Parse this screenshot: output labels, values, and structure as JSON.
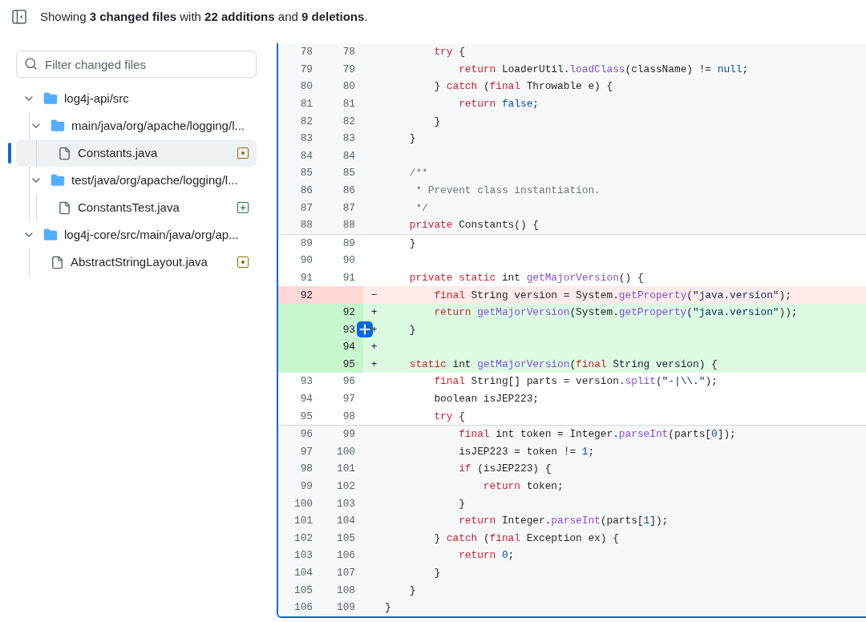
{
  "header": {
    "summary": "Showing **3 changed files** with **22 additions** and **9 deletions**."
  },
  "sidebar": {
    "search": {
      "placeholder": "Filter changed files"
    },
    "tree": [
      {
        "name": "log4j-api/src",
        "kind": "folder",
        "expanded": true,
        "selected": false,
        "children": [
          {
            "name": "main/java/org/apache/logging/l...",
            "kind": "folder",
            "expanded": true,
            "selected": false,
            "children": [
              {
                "name": "Constants.java",
                "kind": "modified_file",
                "selected": true
              }
            ]
          },
          {
            "name": "test/java/org/apache/logging/l...",
            "kind": "folder",
            "expanded": true,
            "selected": false,
            "children": [
              {
                "name": "ConstantsTest.java",
                "kind": "added_file",
                "selected": false
              }
            ]
          }
        ]
      },
      {
        "name": "log4j-core/src/main/java/org/ap...",
        "kind": "folder",
        "expanded": true,
        "selected": false,
        "children": [
          {
            "name": "AbstractStringLayout.java",
            "kind": "modified_file",
            "selected": false
          }
        ]
      }
    ]
  },
  "diff": {
    "rows": [
      {
        "kind": "expanded",
        "old": "78",
        "new": "78",
        "comment_button": false,
        "tokens": [
          {
            "kind": "keyword",
            "text": "        try"
          },
          {
            "kind": "plain",
            "text": " {"
          }
        ]
      },
      {
        "kind": "expanded",
        "old": "79",
        "new": "79",
        "comment_button": false,
        "tokens": [
          {
            "kind": "keyword",
            "text": "            return"
          },
          {
            "kind": "plain",
            "text": " LoaderUtil."
          },
          {
            "kind": "function",
            "text": "loadClass"
          },
          {
            "kind": "plain",
            "text": "(className) != "
          },
          {
            "kind": "constant",
            "text": "null"
          },
          {
            "kind": "plain",
            "text": ";"
          }
        ]
      },
      {
        "kind": "expanded",
        "old": "80",
        "new": "80",
        "comment_button": false,
        "tokens": [
          {
            "kind": "plain",
            "text": "        } "
          },
          {
            "kind": "keyword",
            "text": "catch"
          },
          {
            "kind": "plain",
            "text": " ("
          },
          {
            "kind": "keyword",
            "text": "final"
          },
          {
            "kind": "plain",
            "text": " Throwable e) {"
          }
        ]
      },
      {
        "kind": "expanded",
        "old": "81",
        "new": "81",
        "comment_button": false,
        "tokens": [
          {
            "kind": "keyword",
            "text": "            return"
          },
          {
            "kind": "constant",
            "text": " false"
          },
          {
            "kind": "plain",
            "text": ";"
          }
        ]
      },
      {
        "kind": "expanded",
        "old": "82",
        "new": "82",
        "comment_button": false,
        "tokens": [
          {
            "kind": "plain",
            "text": "        }"
          }
        ]
      },
      {
        "kind": "expanded",
        "old": "83",
        "new": "83",
        "comment_button": false,
        "tokens": [
          {
            "kind": "plain",
            "text": "    }"
          }
        ]
      },
      {
        "kind": "expanded",
        "old": "84",
        "new": "84",
        "comment_button": false,
        "tokens": []
      },
      {
        "kind": "expanded",
        "old": "85",
        "new": "85",
        "comment_button": false,
        "tokens": [
          {
            "kind": "comment",
            "text": "    /**"
          }
        ]
      },
      {
        "kind": "expanded",
        "old": "86",
        "new": "86",
        "comment_button": false,
        "tokens": [
          {
            "kind": "comment",
            "text": "     * Prevent class instantiation."
          }
        ]
      },
      {
        "kind": "expanded",
        "old": "87",
        "new": "87",
        "comment_button": false,
        "tokens": [
          {
            "kind": "comment",
            "text": "     */"
          }
        ]
      },
      {
        "kind": "expanded",
        "old": "88",
        "new": "88",
        "comment_button": false,
        "tokens": [
          {
            "kind": "keyword",
            "text": "    private"
          },
          {
            "kind": "plain",
            "text": " Constants() {"
          }
        ]
      },
      {
        "kind": "context",
        "old": "89",
        "new": "89",
        "comment_button": false,
        "tokens": [
          {
            "kind": "plain",
            "text": "    }"
          }
        ]
      },
      {
        "kind": "context",
        "old": "90",
        "new": "90",
        "comment_button": false,
        "tokens": []
      },
      {
        "kind": "context",
        "old": "91",
        "new": "91",
        "comment_button": false,
        "tokens": [
          {
            "kind": "keyword",
            "text": "    private static"
          },
          {
            "kind": "plain",
            "text": " int "
          },
          {
            "kind": "function",
            "text": "getMajorVersion"
          },
          {
            "kind": "plain",
            "text": "() {"
          }
        ]
      },
      {
        "kind": "deletion",
        "old": "92",
        "marker": "−",
        "comment_button": false,
        "tokens": [
          {
            "kind": "keyword",
            "text": "        final"
          },
          {
            "kind": "plain",
            "text": " String version = System."
          },
          {
            "kind": "function",
            "text": "getProperty"
          },
          {
            "kind": "plain",
            "text": "("
          },
          {
            "kind": "string",
            "text": "\"java.version\""
          },
          {
            "kind": "plain",
            "text": ");"
          }
        ]
      },
      {
        "kind": "addition",
        "new": "92",
        "marker": "+",
        "comment_button": false,
        "tokens": [
          {
            "kind": "keyword",
            "text": "        return"
          },
          {
            "kind": "function",
            "text": " getMajorVersion"
          },
          {
            "kind": "plain",
            "text": "(System."
          },
          {
            "kind": "function",
            "text": "getProperty"
          },
          {
            "kind": "plain",
            "text": "("
          },
          {
            "kind": "string",
            "text": "\"java.version\""
          },
          {
            "kind": "plain",
            "text": "));"
          }
        ]
      },
      {
        "kind": "addition",
        "new": "93",
        "marker": "+",
        "comment_button": true,
        "tokens": [
          {
            "kind": "plain",
            "text": "    }"
          }
        ]
      },
      {
        "kind": "addition",
        "new": "94",
        "marker": "+",
        "comment_button": false,
        "tokens": []
      },
      {
        "kind": "addition",
        "new": "95",
        "marker": "+",
        "comment_button": false,
        "tokens": [
          {
            "kind": "keyword",
            "text": "    static"
          },
          {
            "kind": "plain",
            "text": " int "
          },
          {
            "kind": "function",
            "text": "getMajorVersion"
          },
          {
            "kind": "plain",
            "text": "("
          },
          {
            "kind": "keyword",
            "text": "final"
          },
          {
            "kind": "plain",
            "text": " String version) {"
          }
        ]
      },
      {
        "kind": "context",
        "old": "93",
        "new": "96",
        "comment_button": false,
        "tokens": [
          {
            "kind": "keyword",
            "text": "        final"
          },
          {
            "kind": "plain",
            "text": " String[] parts = version."
          },
          {
            "kind": "function",
            "text": "split"
          },
          {
            "kind": "plain",
            "text": "("
          },
          {
            "kind": "string",
            "text": "\"-|\\\\.\""
          },
          {
            "kind": "plain",
            "text": ");"
          }
        ]
      },
      {
        "kind": "context",
        "old": "94",
        "new": "97",
        "comment_button": false,
        "tokens": [
          {
            "kind": "plain",
            "text": "        boolean isJEP223;"
          }
        ]
      },
      {
        "kind": "context",
        "old": "95",
        "new": "98",
        "comment_button": false,
        "tokens": [
          {
            "kind": "keyword",
            "text": "        try"
          },
          {
            "kind": "plain",
            "text": " {"
          }
        ]
      },
      {
        "kind": "expanded",
        "old": "96",
        "new": "99",
        "comment_button": false,
        "tokens": [
          {
            "kind": "keyword",
            "text": "            final"
          },
          {
            "kind": "plain",
            "text": " int token = Integer."
          },
          {
            "kind": "function",
            "text": "parseInt"
          },
          {
            "kind": "plain",
            "text": "(parts["
          },
          {
            "kind": "constant",
            "text": "0"
          },
          {
            "kind": "plain",
            "text": "]);"
          }
        ]
      },
      {
        "kind": "expanded",
        "old": "97",
        "new": "100",
        "comment_button": false,
        "tokens": [
          {
            "kind": "plain",
            "text": "            isJEP223 = token != "
          },
          {
            "kind": "constant",
            "text": "1"
          },
          {
            "kind": "plain",
            "text": ";"
          }
        ]
      },
      {
        "kind": "expanded",
        "old": "98",
        "new": "101",
        "comment_button": false,
        "tokens": [
          {
            "kind": "keyword",
            "text": "            if"
          },
          {
            "kind": "plain",
            "text": " (isJEP223) {"
          }
        ]
      },
      {
        "kind": "expanded",
        "old": "99",
        "new": "102",
        "comment_button": false,
        "tokens": [
          {
            "kind": "keyword",
            "text": "                return"
          },
          {
            "kind": "plain",
            "text": " token;"
          }
        ]
      },
      {
        "kind": "expanded",
        "old": "100",
        "new": "103",
        "comment_button": false,
        "tokens": [
          {
            "kind": "plain",
            "text": "            }"
          }
        ]
      },
      {
        "kind": "expanded",
        "old": "101",
        "new": "104",
        "comment_button": false,
        "tokens": [
          {
            "kind": "keyword",
            "text": "            return"
          },
          {
            "kind": "plain",
            "text": " Integer."
          },
          {
            "kind": "function",
            "text": "parseInt"
          },
          {
            "kind": "plain",
            "text": "(parts["
          },
          {
            "kind": "constant",
            "text": "1"
          },
          {
            "kind": "plain",
            "text": "]);"
          }
        ]
      },
      {
        "kind": "expanded",
        "old": "102",
        "new": "105",
        "comment_button": false,
        "tokens": [
          {
            "kind": "plain",
            "text": "        } "
          },
          {
            "kind": "keyword",
            "text": "catch"
          },
          {
            "kind": "plain",
            "text": " ("
          },
          {
            "kind": "keyword",
            "text": "final"
          },
          {
            "kind": "plain",
            "text": " Exception ex) {"
          }
        ]
      },
      {
        "kind": "expanded",
        "old": "103",
        "new": "106",
        "comment_button": false,
        "tokens": [
          {
            "kind": "keyword",
            "text": "            return"
          },
          {
            "kind": "constant",
            "text": " 0"
          },
          {
            "kind": "plain",
            "text": ";"
          }
        ]
      },
      {
        "kind": "expanded",
        "old": "104",
        "new": "107",
        "comment_button": false,
        "tokens": [
          {
            "kind": "plain",
            "text": "        }"
          }
        ]
      },
      {
        "kind": "expanded",
        "old": "105",
        "new": "108",
        "comment_button": false,
        "tokens": [
          {
            "kind": "plain",
            "text": "    }"
          }
        ]
      },
      {
        "kind": "expanded",
        "old": "106",
        "new": "109",
        "comment_button": false,
        "tokens": [
          {
            "kind": "plain",
            "text": "}"
          }
        ]
      }
    ]
  }
}
